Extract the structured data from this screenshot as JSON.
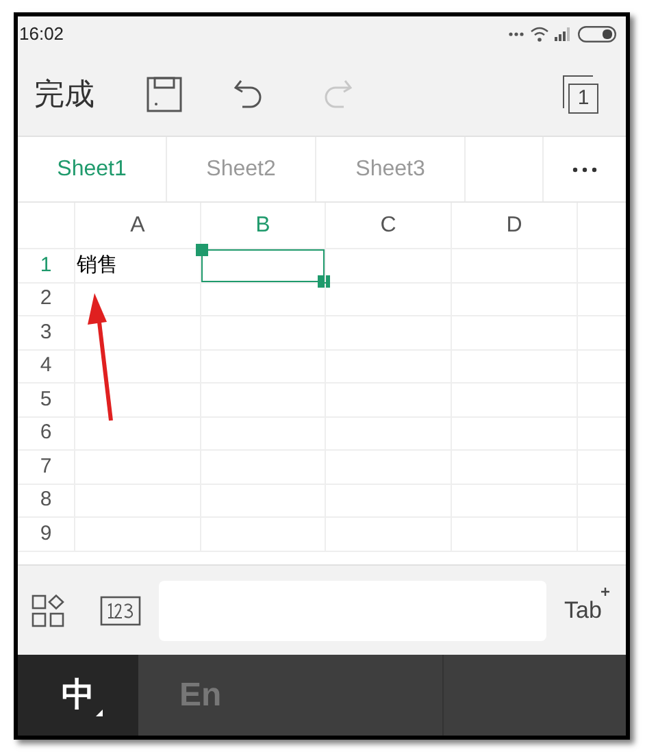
{
  "status_bar": {
    "time": "16:02"
  },
  "toolbar": {
    "done": "完成",
    "redo_disabled": true,
    "sheet_count": "1"
  },
  "sheet_tabs": [
    {
      "label": "Sheet1",
      "selected": true
    },
    {
      "label": "Sheet2",
      "selected": false
    },
    {
      "label": "Sheet3",
      "selected": false
    }
  ],
  "grid": {
    "columns": [
      {
        "label": "A",
        "selected": false
      },
      {
        "label": "B",
        "selected": true
      },
      {
        "label": "C",
        "selected": false
      },
      {
        "label": "D",
        "selected": false
      }
    ],
    "rows": [
      {
        "label": "1",
        "selected": true,
        "cells": [
          "销售"
        ]
      },
      {
        "label": "2",
        "selected": false
      },
      {
        "label": "3",
        "selected": false
      },
      {
        "label": "4",
        "selected": false
      },
      {
        "label": "5",
        "selected": false
      },
      {
        "label": "6",
        "selected": false
      },
      {
        "label": "7",
        "selected": false
      },
      {
        "label": "8",
        "selected": false
      },
      {
        "label": "9",
        "selected": false
      }
    ]
  },
  "input_bar": {
    "tab_key": "Tab"
  },
  "ime_bar": {
    "modes": [
      {
        "label": "中",
        "selected": true
      },
      {
        "label": "En",
        "selected": false
      }
    ]
  }
}
